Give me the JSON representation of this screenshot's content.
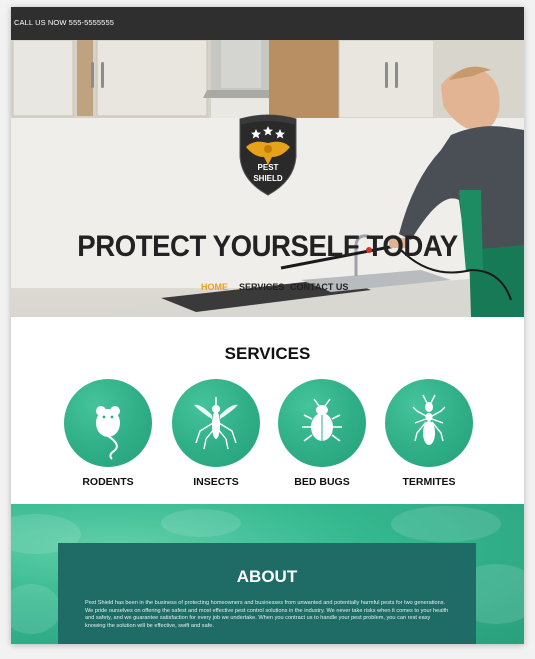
{
  "topbar": {
    "phone_text": "CALL US NOW 555-5555555"
  },
  "logo": {
    "line1": "PEST",
    "line2": "SHIELD",
    "shield_color": "#2a2a2a",
    "wings_color": "#e8a21a"
  },
  "hero": {
    "title": "PROTECT YOURSELF TODAY"
  },
  "nav": {
    "items": [
      {
        "label": "HOME",
        "active": true
      },
      {
        "label": "SERVICES",
        "active": false
      },
      {
        "label": "CONTACT US",
        "active": false
      }
    ],
    "active_color": "#e8a21a"
  },
  "services": {
    "title": "SERVICES",
    "items": [
      {
        "label": "RODENTS",
        "icon": "mouse-icon"
      },
      {
        "label": "INSECTS",
        "icon": "mosquito-icon"
      },
      {
        "label": "BED BUGS",
        "icon": "bedbug-icon"
      },
      {
        "label": "TERMITES",
        "icon": "termite-icon"
      }
    ],
    "accent": "#2fae86"
  },
  "about": {
    "title": "ABOUT",
    "body": "Pest Shield has been in the business of protecting homeowners and businesses from unwanted and potentially harmful pests for two generations. We pride ourselves on offering the safest and most effective pest control solutions in the industry. We never take risks when it comes to your health and safety, and we guarantee satisfaction for every job we undertake. When you contract us to handle your pest problem, you can rest easy knowing the solution will be effective, swift and safe.",
    "box_color": "#1f6b66"
  }
}
